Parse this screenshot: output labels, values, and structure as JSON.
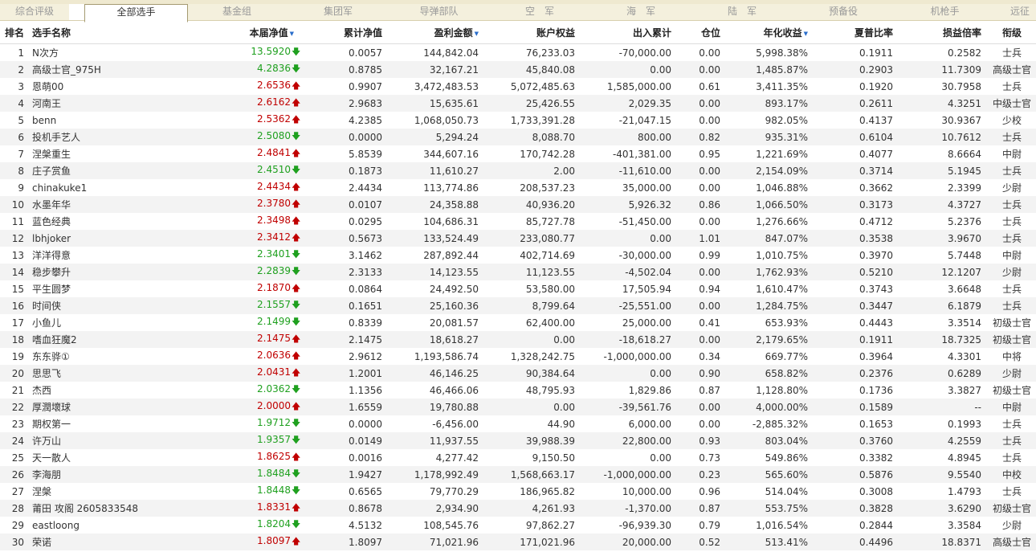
{
  "tabs": [
    {
      "label": "综合评级",
      "active": false
    },
    {
      "label": "全部选手",
      "active": true
    },
    {
      "label": "基金组",
      "active": false
    },
    {
      "label": "集团军",
      "active": false
    },
    {
      "label": "导弹部队",
      "active": false
    },
    {
      "label": "空　军",
      "active": false
    },
    {
      "label": "海　军",
      "active": false
    },
    {
      "label": "陆　军",
      "active": false
    },
    {
      "label": "预备役",
      "active": false
    },
    {
      "label": "机枪手",
      "active": false
    },
    {
      "label": "远征",
      "active": false
    }
  ],
  "headers": [
    {
      "label": "排名",
      "sort": false
    },
    {
      "label": "选手名称",
      "sort": false
    },
    {
      "label": "本届净值",
      "sort": true
    },
    {
      "label": "累计净值",
      "sort": false
    },
    {
      "label": "盈利金额",
      "sort": true
    },
    {
      "label": "账户权益",
      "sort": false
    },
    {
      "label": "出入累计",
      "sort": false
    },
    {
      "label": "仓位",
      "sort": false
    },
    {
      "label": "年化收益",
      "sort": true
    },
    {
      "label": "夏普比率",
      "sort": false
    },
    {
      "label": "损益倍率",
      "sort": false
    },
    {
      "label": "衔级",
      "sort": false
    }
  ],
  "sort_icon": "▼",
  "arrow_up": "🡅",
  "arrow_down": "🡇",
  "colors": {
    "up": "#c00000",
    "down": "#1fa01f"
  },
  "rows": [
    {
      "rank": "1",
      "name": "N次方",
      "nav": "13.5920",
      "dir": "down",
      "cum": "0.0057",
      "profit": "144,842.04",
      "equity": "76,233.03",
      "flow": "-70,000.00",
      "pos": "0.00",
      "annual": "5,998.38%",
      "sharpe": "0.1911",
      "pl": "0.2582",
      "grade": "士兵"
    },
    {
      "rank": "2",
      "name": "高级士官_975H",
      "nav": "4.2836",
      "dir": "down",
      "cum": "0.8785",
      "profit": "32,167.21",
      "equity": "45,840.08",
      "flow": "0.00",
      "pos": "0.00",
      "annual": "1,485.87%",
      "sharpe": "0.2903",
      "pl": "11.7309",
      "grade": "高级士官"
    },
    {
      "rank": "3",
      "name": "恩萌00",
      "nav": "2.6536",
      "dir": "up",
      "cum": "0.9907",
      "profit": "3,472,483.53",
      "equity": "5,072,485.63",
      "flow": "1,585,000.00",
      "pos": "0.61",
      "annual": "3,411.35%",
      "sharpe": "0.1920",
      "pl": "30.7958",
      "grade": "士兵"
    },
    {
      "rank": "4",
      "name": "河南王",
      "nav": "2.6162",
      "dir": "up",
      "cum": "2.9683",
      "profit": "15,635.61",
      "equity": "25,426.55",
      "flow": "2,029.35",
      "pos": "0.00",
      "annual": "893.17%",
      "sharpe": "0.2611",
      "pl": "4.3251",
      "grade": "中级士官"
    },
    {
      "rank": "5",
      "name": "benn",
      "nav": "2.5362",
      "dir": "up",
      "cum": "4.2385",
      "profit": "1,068,050.73",
      "equity": "1,733,391.28",
      "flow": "-21,047.15",
      "pos": "0.00",
      "annual": "982.05%",
      "sharpe": "0.4137",
      "pl": "30.9367",
      "grade": "少校"
    },
    {
      "rank": "6",
      "name": "投机手艺人",
      "nav": "2.5080",
      "dir": "down",
      "cum": "0.0000",
      "profit": "5,294.24",
      "equity": "8,088.70",
      "flow": "800.00",
      "pos": "0.82",
      "annual": "935.31%",
      "sharpe": "0.6104",
      "pl": "10.7612",
      "grade": "士兵"
    },
    {
      "rank": "7",
      "name": "涅槃重生",
      "nav": "2.4841",
      "dir": "up",
      "cum": "5.8539",
      "profit": "344,607.16",
      "equity": "170,742.28",
      "flow": "-401,381.00",
      "pos": "0.95",
      "annual": "1,221.69%",
      "sharpe": "0.4077",
      "pl": "8.6664",
      "grade": "中尉"
    },
    {
      "rank": "8",
      "name": "庄子赏鱼",
      "nav": "2.4510",
      "dir": "down",
      "cum": "0.1873",
      "profit": "11,610.27",
      "equity": "2.00",
      "flow": "-11,610.00",
      "pos": "0.00",
      "annual": "2,154.09%",
      "sharpe": "0.3714",
      "pl": "5.1945",
      "grade": "士兵"
    },
    {
      "rank": "9",
      "name": "chinakuke1",
      "nav": "2.4434",
      "dir": "up",
      "cum": "2.4434",
      "profit": "113,774.86",
      "equity": "208,537.23",
      "flow": "35,000.00",
      "pos": "0.00",
      "annual": "1,046.88%",
      "sharpe": "0.3662",
      "pl": "2.3399",
      "grade": "少尉"
    },
    {
      "rank": "10",
      "name": "水墨年华",
      "nav": "2.3780",
      "dir": "up",
      "cum": "0.0107",
      "profit": "24,358.88",
      "equity": "40,936.20",
      "flow": "5,926.32",
      "pos": "0.86",
      "annual": "1,066.50%",
      "sharpe": "0.3173",
      "pl": "4.3727",
      "grade": "士兵"
    },
    {
      "rank": "11",
      "name": "蓝色经典",
      "nav": "2.3498",
      "dir": "up",
      "cum": "0.0295",
      "profit": "104,686.31",
      "equity": "85,727.78",
      "flow": "-51,450.00",
      "pos": "0.00",
      "annual": "1,276.66%",
      "sharpe": "0.4712",
      "pl": "5.2376",
      "grade": "士兵"
    },
    {
      "rank": "12",
      "name": "lbhjoker",
      "nav": "2.3412",
      "dir": "up",
      "cum": "0.5673",
      "profit": "133,524.49",
      "equity": "233,080.77",
      "flow": "0.00",
      "pos": "1.01",
      "annual": "847.07%",
      "sharpe": "0.3538",
      "pl": "3.9670",
      "grade": "士兵"
    },
    {
      "rank": "13",
      "name": "洋洋得意",
      "nav": "2.3401",
      "dir": "down",
      "cum": "3.1462",
      "profit": "287,892.44",
      "equity": "402,714.69",
      "flow": "-30,000.00",
      "pos": "0.99",
      "annual": "1,010.75%",
      "sharpe": "0.3970",
      "pl": "5.7448",
      "grade": "中尉"
    },
    {
      "rank": "14",
      "name": "稳步攀升",
      "nav": "2.2839",
      "dir": "down",
      "cum": "2.3133",
      "profit": "14,123.55",
      "equity": "11,123.55",
      "flow": "-4,502.04",
      "pos": "0.00",
      "annual": "1,762.93%",
      "sharpe": "0.5210",
      "pl": "12.1207",
      "grade": "少尉"
    },
    {
      "rank": "15",
      "name": "平生圆梦",
      "nav": "2.1870",
      "dir": "up",
      "cum": "0.0864",
      "profit": "24,492.50",
      "equity": "53,580.00",
      "flow": "17,505.94",
      "pos": "0.94",
      "annual": "1,610.47%",
      "sharpe": "0.3743",
      "pl": "3.6648",
      "grade": "士兵"
    },
    {
      "rank": "16",
      "name": "时间侠",
      "nav": "2.1557",
      "dir": "down",
      "cum": "0.1651",
      "profit": "25,160.36",
      "equity": "8,799.64",
      "flow": "-25,551.00",
      "pos": "0.00",
      "annual": "1,284.75%",
      "sharpe": "0.3447",
      "pl": "6.1879",
      "grade": "士兵"
    },
    {
      "rank": "17",
      "name": "小鱼儿",
      "nav": "2.1499",
      "dir": "down",
      "cum": "0.8339",
      "profit": "20,081.57",
      "equity": "62,400.00",
      "flow": "25,000.00",
      "pos": "0.41",
      "annual": "653.93%",
      "sharpe": "0.4443",
      "pl": "3.3514",
      "grade": "初级士官"
    },
    {
      "rank": "18",
      "name": "嗜血狂魔2",
      "nav": "2.1475",
      "dir": "up",
      "cum": "2.1475",
      "profit": "18,618.27",
      "equity": "0.00",
      "flow": "-18,618.27",
      "pos": "0.00",
      "annual": "2,179.65%",
      "sharpe": "0.1911",
      "pl": "18.7325",
      "grade": "初级士官"
    },
    {
      "rank": "19",
      "name": "东东骅①",
      "nav": "2.0636",
      "dir": "up",
      "cum": "2.9612",
      "profit": "1,193,586.74",
      "equity": "1,328,242.75",
      "flow": "-1,000,000.00",
      "pos": "0.34",
      "annual": "669.77%",
      "sharpe": "0.3964",
      "pl": "4.3301",
      "grade": "中将"
    },
    {
      "rank": "20",
      "name": "思思飞",
      "nav": "2.0431",
      "dir": "up",
      "cum": "1.2001",
      "profit": "46,146.25",
      "equity": "90,384.64",
      "flow": "0.00",
      "pos": "0.90",
      "annual": "658.82%",
      "sharpe": "0.2376",
      "pl": "0.6289",
      "grade": "少尉"
    },
    {
      "rank": "21",
      "name": "杰西",
      "nav": "2.0362",
      "dir": "down",
      "cum": "1.1356",
      "profit": "46,466.06",
      "equity": "48,795.93",
      "flow": "1,829.86",
      "pos": "0.87",
      "annual": "1,128.80%",
      "sharpe": "0.1736",
      "pl": "3.3827",
      "grade": "初级士官"
    },
    {
      "rank": "22",
      "name": "厚潤壞球",
      "nav": "2.0000",
      "dir": "up",
      "cum": "1.6559",
      "profit": "19,780.88",
      "equity": "0.00",
      "flow": "-39,561.76",
      "pos": "0.00",
      "annual": "4,000.00%",
      "sharpe": "0.1589",
      "pl": "--",
      "grade": "中尉"
    },
    {
      "rank": "23",
      "name": "期权第一",
      "nav": "1.9712",
      "dir": "down",
      "cum": "0.0000",
      "profit": "-6,456.00",
      "equity": "44.90",
      "flow": "6,000.00",
      "pos": "0.00",
      "annual": "-2,885.32%",
      "sharpe": "0.1653",
      "pl": "0.1993",
      "grade": "士兵"
    },
    {
      "rank": "24",
      "name": "许万山",
      "nav": "1.9357",
      "dir": "down",
      "cum": "0.0149",
      "profit": "11,937.55",
      "equity": "39,988.39",
      "flow": "22,800.00",
      "pos": "0.93",
      "annual": "803.04%",
      "sharpe": "0.3760",
      "pl": "4.2559",
      "grade": "士兵"
    },
    {
      "rank": "25",
      "name": "天一散人",
      "nav": "1.8625",
      "dir": "up",
      "cum": "0.0016",
      "profit": "4,277.42",
      "equity": "9,150.50",
      "flow": "0.00",
      "pos": "0.73",
      "annual": "549.86%",
      "sharpe": "0.3382",
      "pl": "4.8945",
      "grade": "士兵"
    },
    {
      "rank": "26",
      "name": "李海朋",
      "nav": "1.8484",
      "dir": "down",
      "cum": "1.9427",
      "profit": "1,178,992.49",
      "equity": "1,568,663.17",
      "flow": "-1,000,000.00",
      "pos": "0.23",
      "annual": "565.60%",
      "sharpe": "0.5876",
      "pl": "9.5540",
      "grade": "中校"
    },
    {
      "rank": "27",
      "name": "涅槃",
      "nav": "1.8448",
      "dir": "down",
      "cum": "0.6565",
      "profit": "79,770.29",
      "equity": "186,965.82",
      "flow": "10,000.00",
      "pos": "0.96",
      "annual": "514.04%",
      "sharpe": "0.3008",
      "pl": "1.4793",
      "grade": "士兵"
    },
    {
      "rank": "28",
      "name": "莆田 攻阁 2605833548",
      "nav": "1.8331",
      "dir": "up",
      "cum": "0.8678",
      "profit": "2,934.90",
      "equity": "4,261.93",
      "flow": "-1,370.00",
      "pos": "0.87",
      "annual": "553.75%",
      "sharpe": "0.3828",
      "pl": "3.6290",
      "grade": "初级士官"
    },
    {
      "rank": "29",
      "name": "eastloong",
      "nav": "1.8204",
      "dir": "down",
      "cum": "4.5132",
      "profit": "108,545.76",
      "equity": "97,862.27",
      "flow": "-96,939.30",
      "pos": "0.79",
      "annual": "1,016.54%",
      "sharpe": "0.2844",
      "pl": "3.3584",
      "grade": "少尉"
    },
    {
      "rank": "30",
      "name": "荣诺",
      "nav": "1.8097",
      "dir": "up",
      "cum": "1.8097",
      "profit": "71,021.96",
      "equity": "171,021.96",
      "flow": "20,000.00",
      "pos": "0.52",
      "annual": "513.41%",
      "sharpe": "0.4496",
      "pl": "18.8371",
      "grade": "高级士官"
    }
  ]
}
